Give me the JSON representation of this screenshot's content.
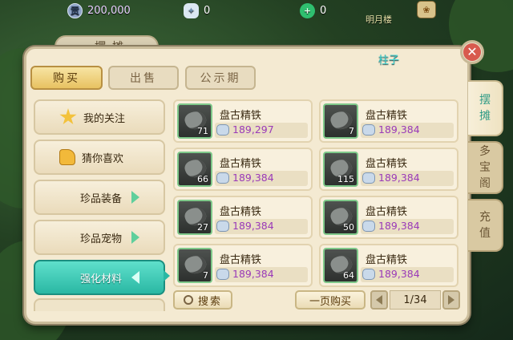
{
  "topbar": {
    "gong_value": "200,000",
    "gong_icon_char": "贡",
    "silver_value": "0",
    "jade_value": "0",
    "tag_text": "明月楼"
  },
  "panel": {
    "title": "摆摊",
    "player_name": "柱子"
  },
  "tabs": {
    "buy": "购买",
    "sell": "出售",
    "notice": "公示期"
  },
  "categories": {
    "follow": "我的关注",
    "guess": "猜你喜欢",
    "equip": "珍品装备",
    "pet": "珍品宠物",
    "material": "强化材料"
  },
  "items": [
    {
      "name": "盘古精铁",
      "qty": "71",
      "price": "189,297"
    },
    {
      "name": "盘古精铁",
      "qty": "7",
      "price": "189,384"
    },
    {
      "name": "盘古精铁",
      "qty": "66",
      "price": "189,384"
    },
    {
      "name": "盘古精铁",
      "qty": "115",
      "price": "189,384"
    },
    {
      "name": "盘古精铁",
      "qty": "27",
      "price": "189,384"
    },
    {
      "name": "盘古精铁",
      "qty": "50",
      "price": "189,384"
    },
    {
      "name": "盘古精铁",
      "qty": "7",
      "price": "189,384"
    },
    {
      "name": "盘古精铁",
      "qty": "64",
      "price": "189,384"
    }
  ],
  "bottom": {
    "search_label": "搜索",
    "buy_page_label": "一页购买",
    "page_indicator": "1/34"
  },
  "side_tabs": {
    "stall_top": "摆",
    "stall_bottom": "摊",
    "shop_top": "多",
    "shop_mid": "宝",
    "shop_bottom": "阁",
    "recharge_top": "充",
    "recharge_bottom": "值"
  },
  "colors": {
    "accent_teal": "#2ab8a3",
    "price_purple": "#9a3ab8",
    "panel_bg": "#f4ead2"
  }
}
